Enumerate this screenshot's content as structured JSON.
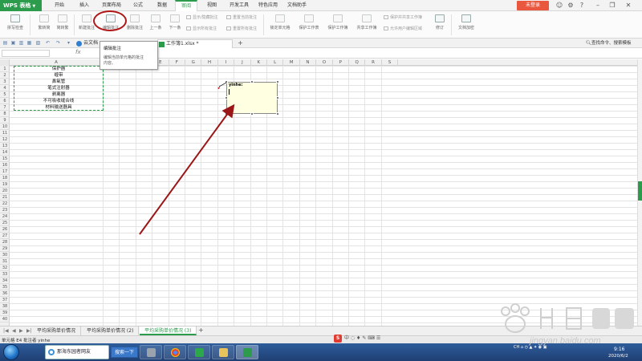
{
  "titlebar": {
    "app_name": "WPS 表格",
    "menu": [
      "开始",
      "插入",
      "页面布局",
      "公式",
      "数据",
      "审阅",
      "视图",
      "开发工具",
      "特色应用",
      "文档助手"
    ],
    "active_menu": "审阅",
    "login_label": "未登录"
  },
  "ribbon": {
    "spell_check": "拼写检查",
    "traditional_to_simplified": "繁转简",
    "simplified_to_traditional": "简转繁",
    "new_comment": "新建批注",
    "edit_comment": "编辑批注",
    "delete_comment": "删除批注",
    "prev_comment": "上一条",
    "next_comment": "下一条",
    "show_hide_comment": "显示/隐藏批注",
    "reset_current_comment": "重置当前批注",
    "show_all_comments": "显示所有批注",
    "reset_all_comments": "重置所有批注",
    "lock_cells": "锁定单元格",
    "protect_sheet": "保护工作表",
    "protect_workbook": "保护工作簿",
    "share_workbook": "共享工作簿",
    "protect_shared_workbook": "保护并共享工作簿",
    "allow_edit_ranges": "允许用户编辑区域",
    "track_changes": "修订",
    "doc_encrypt": "文档加密"
  },
  "doctabs": {
    "cloud": "云文档",
    "workbook": "工作簿1.xlsx *",
    "add": "+",
    "command_search": "查找命令、搜索模板"
  },
  "formula_bar": {
    "fx": "fx"
  },
  "tooltip": {
    "title": "编辑批注",
    "description_line1": "编辑当前单元格的批注",
    "description_line2": "内容。"
  },
  "grid": {
    "columns": [
      "A",
      "B",
      "C",
      "D",
      "E",
      "F",
      "G",
      "H",
      "I",
      "J",
      "K",
      "L",
      "M",
      "N",
      "O",
      "P",
      "Q",
      "R",
      "S"
    ],
    "row_count": 40,
    "column_a_values": [
      "保护器",
      "缠带",
      "鼻氧管",
      "笔式注射器",
      "剥离器",
      "不可吸收缝合线",
      "材料输送器具"
    ]
  },
  "comment": {
    "author": "yinhe:"
  },
  "sheets": {
    "tabs": [
      "平均采购单价情况",
      "平均采购单价情况 (2)",
      "平均采购单价情况 (3)"
    ],
    "active_index": 2,
    "add": "+"
  },
  "status": {
    "text": "单元格 E4 批注者 yinhe"
  },
  "taskbar": {
    "ie_title": "那海东园者网友",
    "search_label": "搜索一下",
    "time": "9:16",
    "date": "2020/6/2"
  },
  "colors": {
    "wps_green": "#2c9b4b",
    "circle_red": "#b01818",
    "arrow_red": "#9b1616",
    "comment_bg": "#ffffe1"
  }
}
